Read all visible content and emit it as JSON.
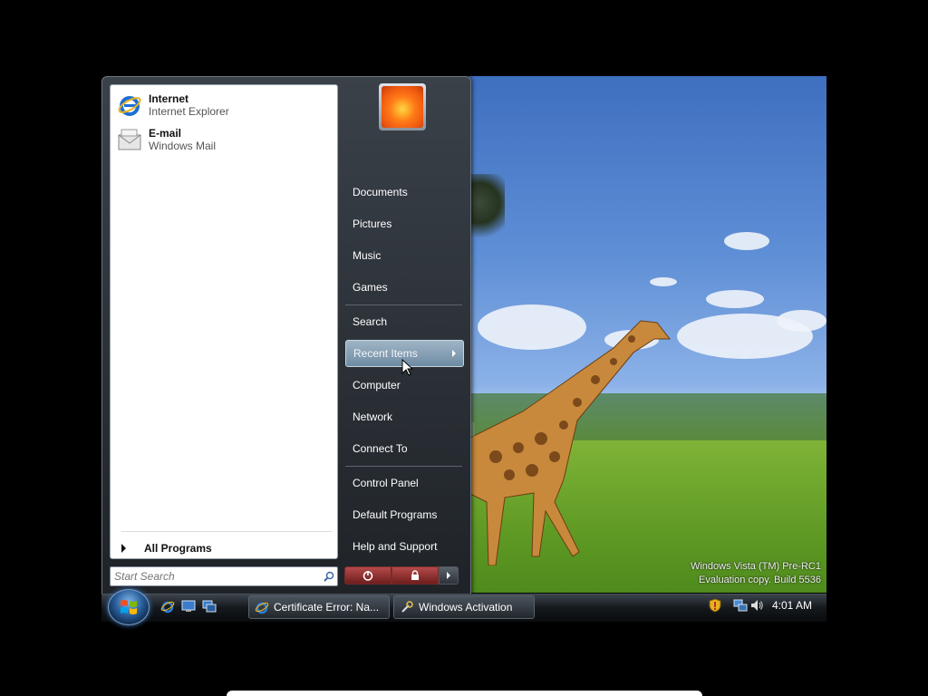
{
  "start_menu": {
    "pinned": [
      {
        "title": "Internet",
        "subtitle": "Internet Explorer",
        "icon": "internet-explorer-icon"
      },
      {
        "title": "E-mail",
        "subtitle": "Windows Mail",
        "icon": "mail-icon"
      }
    ],
    "all_programs_label": "All Programs",
    "search_placeholder": "Start Search",
    "user_name": "",
    "right_items": {
      "documents": "Documents",
      "pictures": "Pictures",
      "music": "Music",
      "games": "Games",
      "search": "Search",
      "recent_items": "Recent Items",
      "computer": "Computer",
      "network": "Network",
      "connect_to": "Connect To",
      "control_panel": "Control Panel",
      "default_programs": "Default Programs",
      "help_support": "Help and Support"
    },
    "highlighted_item": "Recent Items",
    "power_buttons": [
      "power-icon",
      "lock-icon",
      "arrow-right-icon"
    ]
  },
  "taskbar": {
    "tasks": [
      {
        "label": "Certificate Error: Na...",
        "icon": "internet-explorer-icon"
      },
      {
        "label": "Windows Activation",
        "icon": "activation-icon"
      }
    ],
    "quick_launch": [
      "internet-explorer-icon",
      "show-desktop-icon",
      "switch-windows-icon"
    ],
    "tray_icons": [
      "security-shield-icon",
      "network-icon",
      "volume-icon"
    ],
    "clock": "4:01 AM"
  },
  "desktop": {
    "watermark_line1": "Windows Vista (TM) Pre-RC1",
    "watermark_line2": "Evaluation copy. Build 5536"
  },
  "colors": {
    "menu_dark": "#1f2328",
    "highlight": "#8aa3b7",
    "power_red": "#9a3a3a"
  }
}
